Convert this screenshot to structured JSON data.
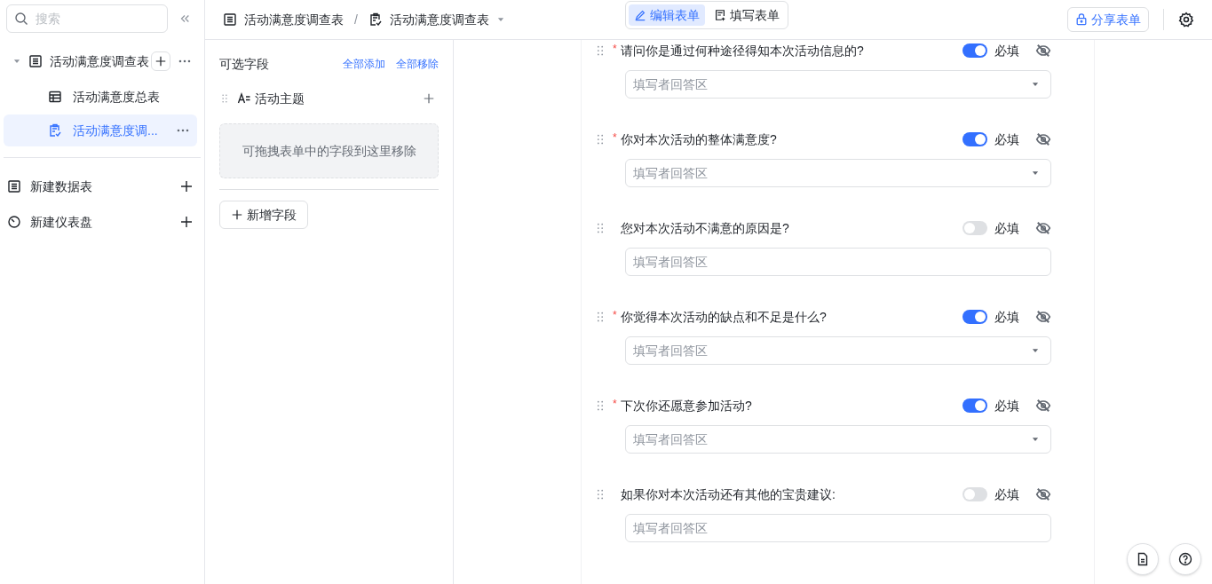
{
  "sidebar": {
    "search": {
      "placeholder": "搜索"
    },
    "tree": [
      {
        "label": "活动满意度调查表",
        "kind": "table",
        "expanded": true,
        "selected": false,
        "children": [
          {
            "label": "活动满意度总表",
            "kind": "grid",
            "selected": false
          },
          {
            "label": "活动满意度调...",
            "kind": "form",
            "selected": true
          }
        ]
      }
    ],
    "actions": [
      {
        "label": "新建数据表",
        "kind": "table"
      },
      {
        "label": "新建仪表盘",
        "kind": "dashboard"
      }
    ]
  },
  "topbar": {
    "separator": "/",
    "breadcrumbs": [
      {
        "label": "活动满意度调查表",
        "kind": "table"
      },
      {
        "label": "活动满意度调查表",
        "kind": "form"
      }
    ],
    "modes": [
      {
        "label": "编辑表单",
        "kind": "edit",
        "selected": true
      },
      {
        "label": "填写表单",
        "kind": "fill",
        "selected": false
      }
    ],
    "share": "分享表单"
  },
  "fields_panel": {
    "title": "可选字段",
    "add_all": "全部添加",
    "remove_all": "全部移除",
    "fields": [
      {
        "label": "活动主题"
      }
    ],
    "drop_hint": "可拖拽表单中的字段到这里移除",
    "new_field": "新增字段"
  },
  "questions": [
    {
      "label": "请问你是通过何种途径得知本次活动信息的?",
      "required": true,
      "mark": "*",
      "kind": "select",
      "placeholder": "填写者回答区",
      "required_label": "必填"
    },
    {
      "label": "你对本次活动的整体满意度?",
      "required": true,
      "mark": "*",
      "kind": "select",
      "placeholder": "填写者回答区",
      "required_label": "必填"
    },
    {
      "label": "您对本次活动不满意的原因是?",
      "required": false,
      "kind": "text",
      "placeholder": "填写者回答区",
      "required_label": "必填"
    },
    {
      "label": "你觉得本次活动的缺点和不足是什么?",
      "required": true,
      "mark": "*",
      "kind": "select",
      "placeholder": "填写者回答区",
      "required_label": "必填"
    },
    {
      "label": "下次你还愿意参加活动?",
      "required": true,
      "mark": "*",
      "kind": "select",
      "placeholder": "填写者回答区",
      "required_label": "必填"
    },
    {
      "label": "如果你对本次活动还有其他的宝贵建议:",
      "required": false,
      "kind": "text",
      "placeholder": "填写者回答区",
      "required_label": "必填"
    }
  ]
}
